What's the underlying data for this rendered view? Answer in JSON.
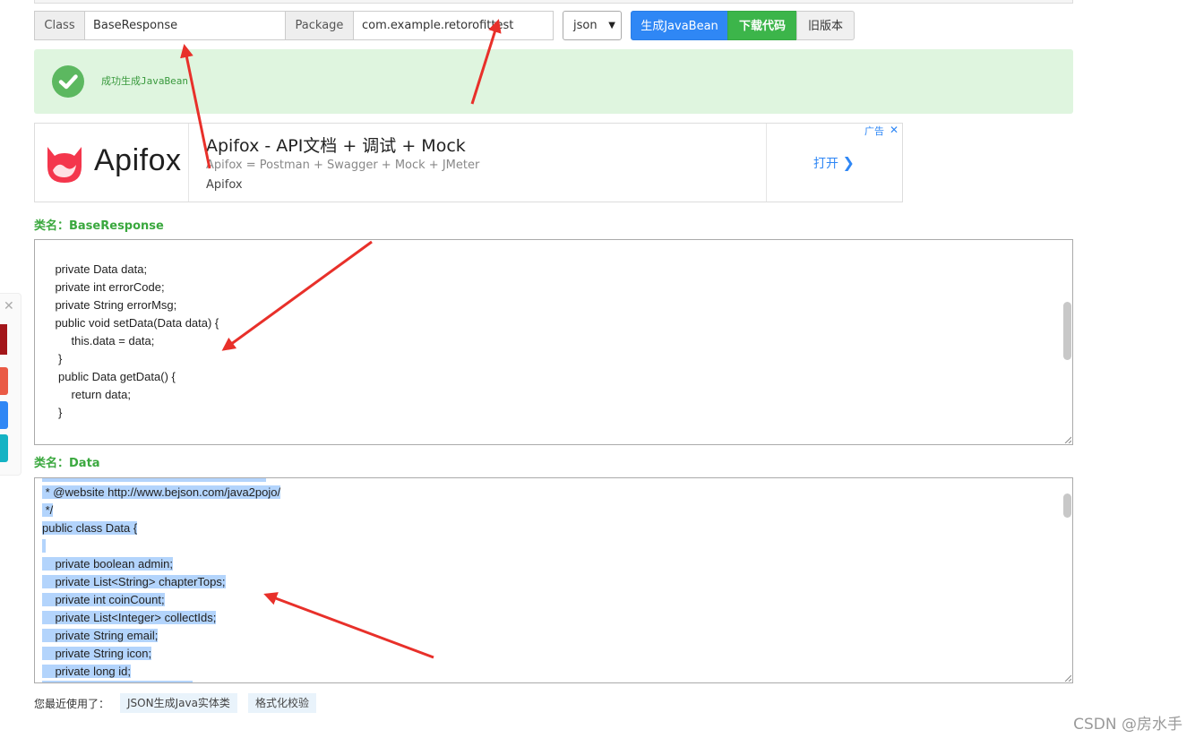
{
  "toolbar": {
    "class_label": "Class",
    "class_value": "BaseResponse",
    "package_label": "Package",
    "package_value": "com.example.retorofittest",
    "format_selected": "json",
    "generate_button": "生成JavaBean",
    "download_button": "下载代码",
    "old_version_button": "旧版本"
  },
  "status": {
    "message": "成功生成JavaBean",
    "color": "#dff5df",
    "icon": "check-circle-icon"
  },
  "ad": {
    "brand": "Apifox",
    "title": "Apifox - API文档 + 调试 + Mock",
    "description": "Apifox = Postman + Swagger + Mock + JMeter",
    "source": "Apifox",
    "cta": "打开",
    "badge": "广告",
    "close": "✕"
  },
  "sections": [
    {
      "label": "类名：BaseResponse",
      "lines": [
        "",
        "    private Data data;",
        "    private int errorCode;",
        "    private String errorMsg;",
        "    public void setData(Data data) {",
        "         this.data = data;",
        "     }",
        "     public Data getData() {",
        "         return data;",
        "     }"
      ]
    },
    {
      "label": "类名：Data",
      "lines": [
        " * @website http://www.bejson.com/java2pojo/",
        " */",
        "public class Data {",
        " ",
        "    private boolean admin;",
        "    private List<String> chapterTops;",
        "    private int coinCount;",
        "    private List<Integer> collectIds;",
        "    private String email;",
        "    private String icon;",
        "    private long id;"
      ]
    }
  ],
  "footer": {
    "recent_label": "您最近使用了：",
    "recent_items": [
      "JSON生成Java实体类",
      "格式化校验"
    ],
    "watermark": "CSDN @房水手"
  },
  "colors": {
    "primary": "#2f87f5",
    "success": "#3cb54a",
    "selection": "#b3d4fc",
    "annotation_arrow": "#e8302a"
  }
}
